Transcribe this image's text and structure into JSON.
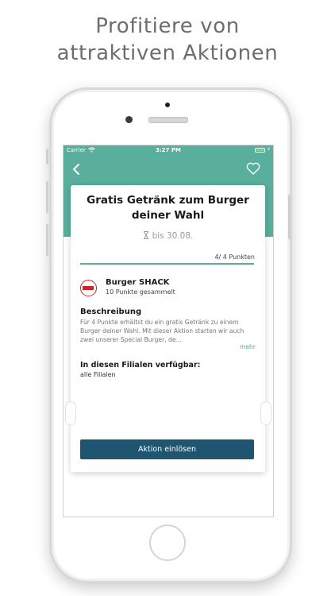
{
  "headline": {
    "line1": "Profitiere von",
    "line2": "attraktiven Aktionen"
  },
  "status_bar": {
    "carrier": "Carrier",
    "time": "3:27 PM",
    "wifi_icon": "wifi-icon",
    "battery_icon": "battery-icon"
  },
  "nav": {
    "back_icon": "chevron-left-icon",
    "favorite_icon": "heart-outline-icon"
  },
  "offer": {
    "title": "Gratis Getränk zum Burger deiner Wahl",
    "valid_until": "bis 30.08.",
    "valid_icon": "hourglass-icon",
    "points_progress_text": "4/ 4 Punkten",
    "points_progress": 1.0
  },
  "shop": {
    "name": "Burger SHACK",
    "points_collected": "10 Punkte gesammelt"
  },
  "description": {
    "heading": "Beschreibung",
    "text": "Für 4 Punkte erhältst du ein gratis Getränk zu einem Burger deiner Wahl. Mit dieser Aktion starten wir auch zwei unserer Special Burger, de...",
    "more_label": "mehr"
  },
  "branches": {
    "heading": "In diesen Filialen verfügbar:",
    "text": "alle Filialen"
  },
  "action": {
    "redeem_label": "Aktion einlösen"
  },
  "colors": {
    "accent": "#59ae9c",
    "button": "#1f5570",
    "logo_red": "#c7262d"
  }
}
